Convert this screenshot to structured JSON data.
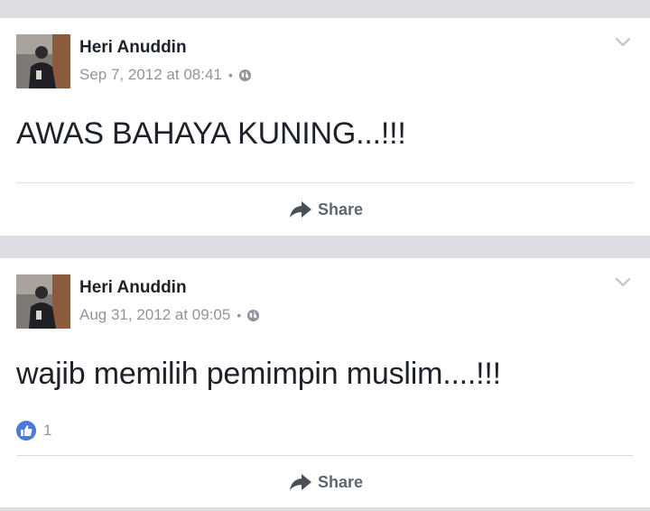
{
  "posts": [
    {
      "author": "Heri Anuddin",
      "timestamp": "Sep 7, 2012 at 08:41",
      "separator": "•",
      "privacy_icon": "globe-icon",
      "text": "AWAS BAHAYA KUNING...!!!",
      "share_label": "Share"
    },
    {
      "author": "Heri Anuddin",
      "timestamp": "Aug 31, 2012 at 09:05",
      "separator": "•",
      "privacy_icon": "globe-icon",
      "text": "wajib memilih pemimpin muslim....!!!",
      "like_count": "1",
      "share_label": "Share"
    }
  ],
  "colors": {
    "background": "#dcdee3",
    "card": "#ffffff",
    "name": "#1d2129",
    "meta": "#90949c",
    "like_badge": "#4a7bd7"
  }
}
